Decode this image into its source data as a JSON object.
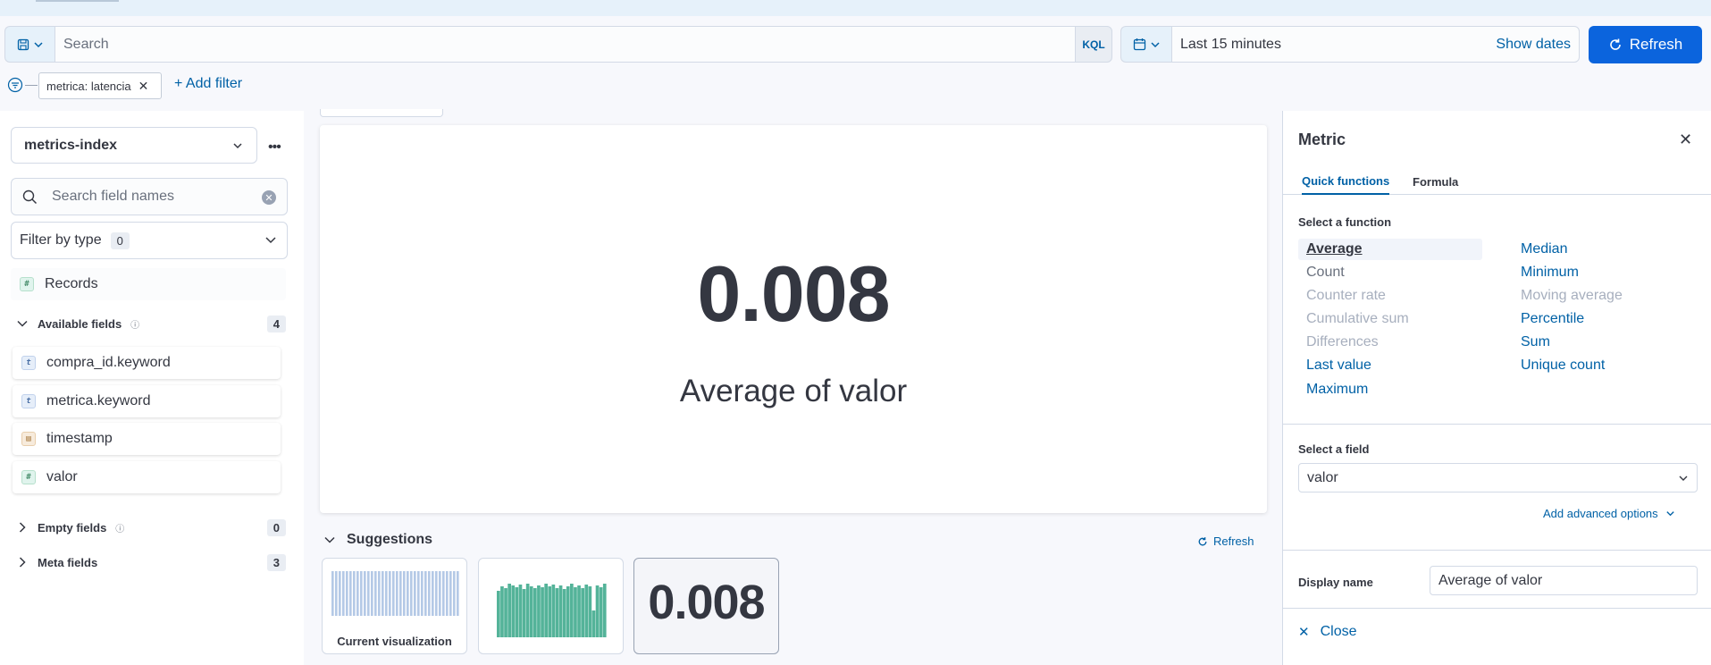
{
  "query": {
    "search_placeholder": "Search",
    "language": "KQL",
    "time_range": "Last 15 minutes",
    "show_dates": "Show dates",
    "refresh_label": "Refresh"
  },
  "filters": {
    "pill": "metrica: latencia",
    "add_filter": "+ Add filter"
  },
  "sidebar": {
    "index_pattern": "metrics-index",
    "search_placeholder": "Search field names",
    "filter_by_type": "Filter by type",
    "filter_count": "0",
    "records": "Records",
    "available_label": "Available fields",
    "available_count": "4",
    "fields": [
      {
        "name": "compra_id.keyword",
        "type": "t"
      },
      {
        "name": "metrica.keyword",
        "type": "t"
      },
      {
        "name": "timestamp",
        "type": "date"
      },
      {
        "name": "valor",
        "type": "#"
      }
    ],
    "empty_label": "Empty fields",
    "empty_count": "0",
    "meta_label": "Meta fields",
    "meta_count": "3"
  },
  "visualization": {
    "value": "0.008",
    "label": "Average of valor"
  },
  "suggestions": {
    "title": "Suggestions",
    "refresh": "Refresh",
    "current_caption": "Current visualization",
    "metric_value": "0.008"
  },
  "flyout": {
    "title": "Metric",
    "tabs": [
      "Quick functions",
      "Formula"
    ],
    "select_function_label": "Select a function",
    "functions_left": [
      "Average",
      "Count",
      "Counter rate",
      "Cumulative sum",
      "Differences",
      "Last value",
      "Maximum"
    ],
    "functions_right": [
      "Median",
      "Minimum",
      "Moving average",
      "Percentile",
      "Sum",
      "Unique count"
    ],
    "select_field_label": "Select a field",
    "field_value": "valor",
    "advanced": "Add advanced options",
    "display_name_label": "Display name",
    "display_name_value": "Average of valor",
    "close": "Close"
  },
  "colors": {
    "accent": "#0061a6",
    "primary_button": "#0b64dd",
    "bar_current": "#b4c9e6",
    "bar_alt": "#54b399"
  }
}
